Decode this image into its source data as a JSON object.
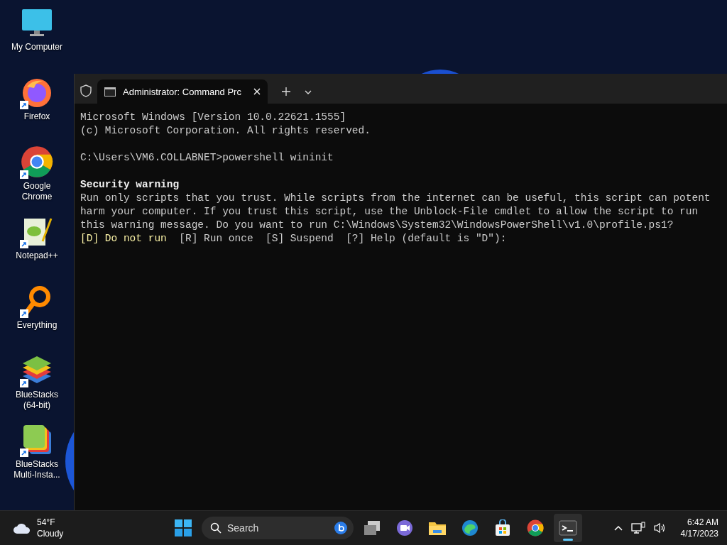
{
  "desktop_icons": [
    {
      "kind": "monitor",
      "label": "My Computer",
      "shortcut": false
    },
    {
      "kind": "firefox",
      "label": "Firefox",
      "shortcut": true
    },
    {
      "kind": "chrome",
      "label": "Google\nChrome",
      "shortcut": true
    },
    {
      "kind": "notepad",
      "label": "Notepad++",
      "shortcut": true
    },
    {
      "kind": "everything",
      "label": "Everything",
      "shortcut": true
    },
    {
      "kind": "bluestacks",
      "label": "BlueStacks\n(64-bit)",
      "shortcut": true
    },
    {
      "kind": "multi",
      "label": "BlueStacks\nMulti-Insta...",
      "shortcut": true
    }
  ],
  "window": {
    "tabs": [
      {
        "title": "Administrator:  Command Prc",
        "selected": true
      }
    ],
    "lines": [
      {
        "spaced": false,
        "segments": [
          {
            "kind": "normal",
            "text": "Microsoft Windows [Version 10.0.22621.1555]"
          }
        ]
      },
      {
        "spaced": false,
        "segments": [
          {
            "kind": "normal",
            "text": "(c) Microsoft Corporation. All rights reserved."
          }
        ]
      },
      {
        "spaced": true,
        "segments": [
          {
            "kind": "normal",
            "text": "C:\\Users\\VM6.COLLABNET>powershell wininit"
          }
        ]
      },
      {
        "spaced": true,
        "segments": [
          {
            "kind": "bold",
            "text": "Security warning"
          }
        ]
      },
      {
        "spaced": false,
        "segments": [
          {
            "kind": "normal",
            "text": "Run only scripts that you trust. While scripts from the internet can be useful, this script can potent"
          }
        ]
      },
      {
        "spaced": false,
        "segments": [
          {
            "kind": "normal",
            "text": "harm your computer. If you trust this script, use the Unblock-File cmdlet to allow the script to run"
          }
        ]
      },
      {
        "spaced": false,
        "segments": [
          {
            "kind": "normal",
            "text": "this warning message. Do you want to run C:\\Windows\\System32\\WindowsPowerShell\\v1.0\\profile.ps1?"
          }
        ]
      },
      {
        "spaced": false,
        "segments": [
          {
            "kind": "accent",
            "text": "[D] Do not run"
          },
          {
            "kind": "normal",
            "text": "  [R] Run once  [S] Suspend  [?] Help (default is \"D\"):"
          }
        ]
      }
    ]
  },
  "taskbar": {
    "weather": {
      "temperature": "54°F",
      "condition": "Cloudy"
    },
    "search": {
      "placeholder": "Search"
    },
    "apps": [
      {
        "kind": "taskview",
        "active": false
      },
      {
        "kind": "meet",
        "active": false
      },
      {
        "kind": "explorer",
        "active": false
      },
      {
        "kind": "edge",
        "active": false
      },
      {
        "kind": "store",
        "active": false
      },
      {
        "kind": "chrome",
        "active": false
      },
      {
        "kind": "terminal",
        "active": true
      }
    ],
    "clock": {
      "time": "6:42 AM",
      "date": "4/17/2023"
    }
  }
}
